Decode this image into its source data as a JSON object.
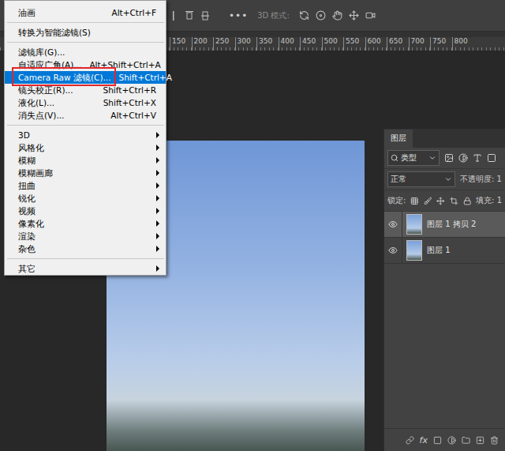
{
  "options_bar": {
    "more": "•••",
    "mode_label": "3D 模式:"
  },
  "ruler": {
    "ticks": [
      "150",
      "200",
      "250",
      "300",
      "350",
      "400",
      "450",
      "500",
      "550",
      "600",
      "650",
      "700",
      "750",
      "800"
    ]
  },
  "filter_menu": {
    "items": [
      {
        "kind": "item",
        "label": "油画",
        "shortcut": "Alt+Ctrl+F",
        "selected": false,
        "annotated": false
      },
      {
        "kind": "separator"
      },
      {
        "kind": "item",
        "label": "转换为智能滤镜(S)",
        "shortcut": "",
        "selected": false,
        "annotated": false
      },
      {
        "kind": "separator"
      },
      {
        "kind": "item",
        "label": "滤镜库(G)...",
        "shortcut": "",
        "selected": false,
        "annotated": false
      },
      {
        "kind": "item",
        "label": "自适应广角(A)...",
        "shortcut": "Alt+Shift+Ctrl+A",
        "selected": false,
        "annotated": false
      },
      {
        "kind": "item",
        "label": "Camera Raw 滤镜(C)...",
        "shortcut": "Shift+Ctrl+A",
        "selected": true,
        "annotated": true
      },
      {
        "kind": "item",
        "label": "镜头校正(R)...",
        "shortcut": "Shift+Ctrl+R",
        "selected": false,
        "annotated": false
      },
      {
        "kind": "item",
        "label": "液化(L)...",
        "shortcut": "Shift+Ctrl+X",
        "selected": false,
        "annotated": false
      },
      {
        "kind": "item",
        "label": "消失点(V)...",
        "shortcut": "Alt+Ctrl+V",
        "selected": false,
        "annotated": false
      },
      {
        "kind": "separator"
      },
      {
        "kind": "submenu",
        "label": "3D",
        "shortcut": "",
        "selected": false,
        "annotated": false
      },
      {
        "kind": "submenu",
        "label": "风格化",
        "shortcut": "",
        "selected": false,
        "annotated": false
      },
      {
        "kind": "submenu",
        "label": "模糊",
        "shortcut": "",
        "selected": false,
        "annotated": false
      },
      {
        "kind": "submenu",
        "label": "模糊画廊",
        "shortcut": "",
        "selected": false,
        "annotated": false
      },
      {
        "kind": "submenu",
        "label": "扭曲",
        "shortcut": "",
        "selected": false,
        "annotated": false
      },
      {
        "kind": "submenu",
        "label": "锐化",
        "shortcut": "",
        "selected": false,
        "annotated": false
      },
      {
        "kind": "submenu",
        "label": "视频",
        "shortcut": "",
        "selected": false,
        "annotated": false
      },
      {
        "kind": "submenu",
        "label": "像素化",
        "shortcut": "",
        "selected": false,
        "annotated": false
      },
      {
        "kind": "submenu",
        "label": "渲染",
        "shortcut": "",
        "selected": false,
        "annotated": false
      },
      {
        "kind": "submenu",
        "label": "杂色",
        "shortcut": "",
        "selected": false,
        "annotated": false
      },
      {
        "kind": "separator"
      },
      {
        "kind": "submenu",
        "label": "其它",
        "shortcut": "",
        "selected": false,
        "annotated": false
      }
    ],
    "annotation_color": "#e0262c"
  },
  "layers_panel": {
    "title": "图层",
    "filter": "类型",
    "blend_mode": "正常",
    "opacity_label": "不透明度: 1",
    "lock_label": "锁定:",
    "fill_label": "填充: 1",
    "fx": "fx",
    "layers": [
      {
        "name": "图层 1 拷贝 2",
        "selected": true,
        "visible": true
      },
      {
        "name": "图层 1",
        "selected": false,
        "visible": true
      }
    ]
  }
}
